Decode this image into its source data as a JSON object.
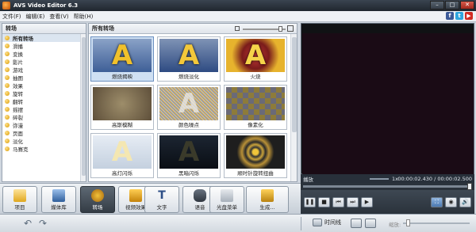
{
  "window": {
    "title": "AVS Video Editor 6.3"
  },
  "menu": [
    "文件(F)",
    "编辑(E)",
    "查看(V)",
    "帮助(H)"
  ],
  "social": [
    "f",
    "t",
    "▶"
  ],
  "categories": {
    "header": "转场",
    "items": [
      "所有转场",
      "滑播",
      "变换",
      "影片",
      "游戏",
      "抽图",
      "效果",
      "旋转",
      "翻转",
      "摇摆",
      "碎裂",
      "弥漫",
      "页面",
      "淡化",
      "马赛克"
    ],
    "selected": "所有转场"
  },
  "gallery": {
    "header": "所有转场",
    "tiles": [
      {
        "label": "燃烧揭映"
      },
      {
        "label": "燃烧淡化"
      },
      {
        "label": "火烧"
      },
      {
        "label": "高斯模糊"
      },
      {
        "label": "颜色噪点"
      },
      {
        "label": "像素化"
      },
      {
        "label": "高灯闪烁"
      },
      {
        "label": "黑暗闪烁"
      },
      {
        "label": "顺时针旋转扭曲"
      }
    ]
  },
  "preview": {
    "status_label": "播放",
    "speed": "1x",
    "time": "00:00:02.430 / 00:00:02.500"
  },
  "toolbar": [
    {
      "label": "项目"
    },
    {
      "label": "媒体库"
    },
    {
      "label": "转场"
    },
    {
      "label": "视频效果"
    },
    {
      "label": "文字"
    },
    {
      "label": "语音"
    },
    {
      "label": "光盘菜单"
    },
    {
      "label": "生成..."
    }
  ],
  "bottom": {
    "timeline_label": "时间线",
    "zoom_label": "缩放:"
  },
  "colors": {
    "accent": "#5b8fd0",
    "dark_panel": "#28303a"
  }
}
